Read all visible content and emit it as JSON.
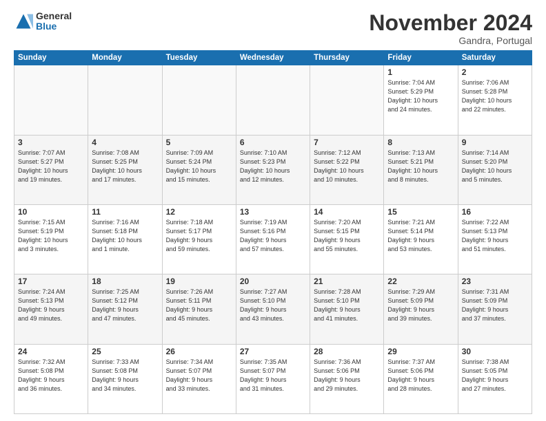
{
  "logo": {
    "general": "General",
    "blue": "Blue"
  },
  "title": "November 2024",
  "location": "Gandra, Portugal",
  "days_header": [
    "Sunday",
    "Monday",
    "Tuesday",
    "Wednesday",
    "Thursday",
    "Friday",
    "Saturday"
  ],
  "weeks": [
    [
      {
        "day": "",
        "detail": ""
      },
      {
        "day": "",
        "detail": ""
      },
      {
        "day": "",
        "detail": ""
      },
      {
        "day": "",
        "detail": ""
      },
      {
        "day": "",
        "detail": ""
      },
      {
        "day": "1",
        "detail": "Sunrise: 7:04 AM\nSunset: 5:29 PM\nDaylight: 10 hours\nand 24 minutes."
      },
      {
        "day": "2",
        "detail": "Sunrise: 7:06 AM\nSunset: 5:28 PM\nDaylight: 10 hours\nand 22 minutes."
      }
    ],
    [
      {
        "day": "3",
        "detail": "Sunrise: 7:07 AM\nSunset: 5:27 PM\nDaylight: 10 hours\nand 19 minutes."
      },
      {
        "day": "4",
        "detail": "Sunrise: 7:08 AM\nSunset: 5:25 PM\nDaylight: 10 hours\nand 17 minutes."
      },
      {
        "day": "5",
        "detail": "Sunrise: 7:09 AM\nSunset: 5:24 PM\nDaylight: 10 hours\nand 15 minutes."
      },
      {
        "day": "6",
        "detail": "Sunrise: 7:10 AM\nSunset: 5:23 PM\nDaylight: 10 hours\nand 12 minutes."
      },
      {
        "day": "7",
        "detail": "Sunrise: 7:12 AM\nSunset: 5:22 PM\nDaylight: 10 hours\nand 10 minutes."
      },
      {
        "day": "8",
        "detail": "Sunrise: 7:13 AM\nSunset: 5:21 PM\nDaylight: 10 hours\nand 8 minutes."
      },
      {
        "day": "9",
        "detail": "Sunrise: 7:14 AM\nSunset: 5:20 PM\nDaylight: 10 hours\nand 5 minutes."
      }
    ],
    [
      {
        "day": "10",
        "detail": "Sunrise: 7:15 AM\nSunset: 5:19 PM\nDaylight: 10 hours\nand 3 minutes."
      },
      {
        "day": "11",
        "detail": "Sunrise: 7:16 AM\nSunset: 5:18 PM\nDaylight: 10 hours\nand 1 minute."
      },
      {
        "day": "12",
        "detail": "Sunrise: 7:18 AM\nSunset: 5:17 PM\nDaylight: 9 hours\nand 59 minutes."
      },
      {
        "day": "13",
        "detail": "Sunrise: 7:19 AM\nSunset: 5:16 PM\nDaylight: 9 hours\nand 57 minutes."
      },
      {
        "day": "14",
        "detail": "Sunrise: 7:20 AM\nSunset: 5:15 PM\nDaylight: 9 hours\nand 55 minutes."
      },
      {
        "day": "15",
        "detail": "Sunrise: 7:21 AM\nSunset: 5:14 PM\nDaylight: 9 hours\nand 53 minutes."
      },
      {
        "day": "16",
        "detail": "Sunrise: 7:22 AM\nSunset: 5:13 PM\nDaylight: 9 hours\nand 51 minutes."
      }
    ],
    [
      {
        "day": "17",
        "detail": "Sunrise: 7:24 AM\nSunset: 5:13 PM\nDaylight: 9 hours\nand 49 minutes."
      },
      {
        "day": "18",
        "detail": "Sunrise: 7:25 AM\nSunset: 5:12 PM\nDaylight: 9 hours\nand 47 minutes."
      },
      {
        "day": "19",
        "detail": "Sunrise: 7:26 AM\nSunset: 5:11 PM\nDaylight: 9 hours\nand 45 minutes."
      },
      {
        "day": "20",
        "detail": "Sunrise: 7:27 AM\nSunset: 5:10 PM\nDaylight: 9 hours\nand 43 minutes."
      },
      {
        "day": "21",
        "detail": "Sunrise: 7:28 AM\nSunset: 5:10 PM\nDaylight: 9 hours\nand 41 minutes."
      },
      {
        "day": "22",
        "detail": "Sunrise: 7:29 AM\nSunset: 5:09 PM\nDaylight: 9 hours\nand 39 minutes."
      },
      {
        "day": "23",
        "detail": "Sunrise: 7:31 AM\nSunset: 5:09 PM\nDaylight: 9 hours\nand 37 minutes."
      }
    ],
    [
      {
        "day": "24",
        "detail": "Sunrise: 7:32 AM\nSunset: 5:08 PM\nDaylight: 9 hours\nand 36 minutes."
      },
      {
        "day": "25",
        "detail": "Sunrise: 7:33 AM\nSunset: 5:08 PM\nDaylight: 9 hours\nand 34 minutes."
      },
      {
        "day": "26",
        "detail": "Sunrise: 7:34 AM\nSunset: 5:07 PM\nDaylight: 9 hours\nand 33 minutes."
      },
      {
        "day": "27",
        "detail": "Sunrise: 7:35 AM\nSunset: 5:07 PM\nDaylight: 9 hours\nand 31 minutes."
      },
      {
        "day": "28",
        "detail": "Sunrise: 7:36 AM\nSunset: 5:06 PM\nDaylight: 9 hours\nand 29 minutes."
      },
      {
        "day": "29",
        "detail": "Sunrise: 7:37 AM\nSunset: 5:06 PM\nDaylight: 9 hours\nand 28 minutes."
      },
      {
        "day": "30",
        "detail": "Sunrise: 7:38 AM\nSunset: 5:05 PM\nDaylight: 9 hours\nand 27 minutes."
      }
    ]
  ]
}
